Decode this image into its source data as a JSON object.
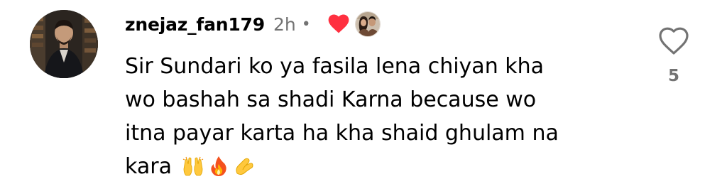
{
  "comment": {
    "username": "znejaz_fan179",
    "timestamp": "2h",
    "separator": "•",
    "creator_liked": true,
    "text_lines": [
      "Sir Sundari ko ya fasila lena chiyan kha",
      "wo bashah sa shadi Karna because wo",
      "itna payar karta ha kha shaid ghulam na",
      "kara"
    ],
    "emojis": [
      "raising-hands",
      "fire",
      "pinching-hand"
    ],
    "like_count": "5"
  },
  "icons": {
    "avatar": "user-avatar",
    "creator_heart": "heart-filled-icon",
    "creator_avatar": "creator-avatar",
    "like": "heart-outline-icon"
  },
  "colors": {
    "text": "#000000",
    "muted": "#737373",
    "heart_red": "#ff3040"
  }
}
